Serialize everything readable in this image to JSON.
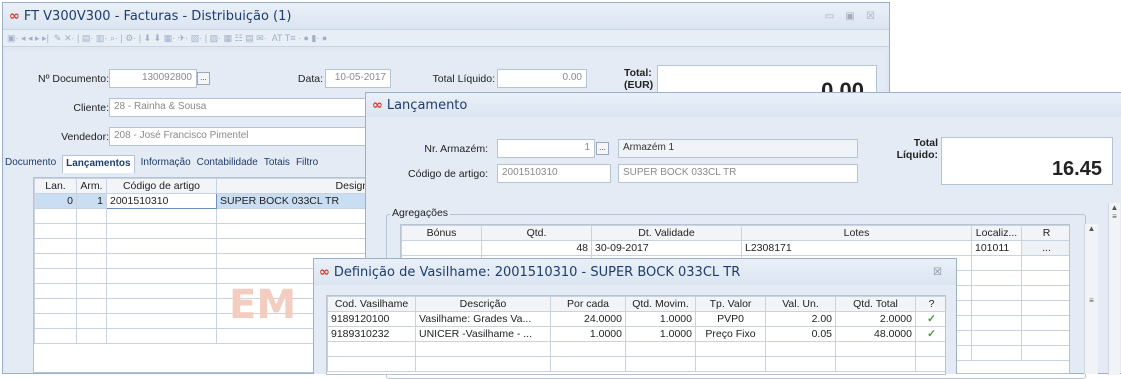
{
  "main": {
    "title": "FT V300V300 - Facturas - Distribuição (1)",
    "doc_label": "Nº Documento:",
    "doc_value": "130092800",
    "date_label": "Data:",
    "date_value": "10-05-2017",
    "total_liq_label": "Total Líquido:",
    "total_liq_value": "0.00",
    "total_label": "Total:",
    "total_unit": "(EUR)",
    "total_value": "0.00",
    "client_label": "Cliente:",
    "client_value": "28 - Rainha & Sousa",
    "seller_label": "Vendedor:",
    "seller_value": "208 - José Francisco Pimentel",
    "tabs": [
      "Documento",
      "Lançamentos",
      "Informação",
      "Contabilidade",
      "Totais",
      "Filtro"
    ],
    "grid_headers": [
      "Lan.",
      "Arm.",
      "Código de artigo",
      "Designação"
    ],
    "grid_row": [
      "0",
      "1",
      "2001510310",
      "SUPER BOCK 033CL TR"
    ],
    "watermark": "EM"
  },
  "lanc": {
    "title": "Lançamento",
    "armazem_label": "Nr. Armazém:",
    "armazem_value": "1",
    "armazem_name": "Armazém 1",
    "codigo_label": "Código de artigo:",
    "codigo_value": "2001510310",
    "codigo_name": "SUPER BOCK 033CL TR",
    "total_label": "Total",
    "liquido_label": "Líquido:",
    "total_value": "16.45",
    "agreg_label": "Agregações",
    "agreg_headers": [
      "Bónus",
      "Qtd.",
      "Dt. Validade",
      "Lotes",
      "Localiz...",
      "R"
    ],
    "agreg_row": [
      "",
      "48",
      "30-09-2017",
      "L2308171",
      "101011",
      "..."
    ]
  },
  "vas": {
    "title": "Definição de Vasilhame: 2001510310 - SUPER BOCK 033CL TR",
    "headers": [
      "Cod. Vasilhame",
      "Descrição",
      "Por cada",
      "Qtd. Movim.",
      "Tp. Valor",
      "Val. Un.",
      "Qtd. Total",
      "?"
    ],
    "rows": [
      [
        "9189120100",
        "Vasilhame: Grades Va...",
        "24.0000",
        "1.0000",
        "PVP0",
        "2.00",
        "2.0000",
        "✓"
      ],
      [
        "9189310232",
        "UNICER -Vasilhame - ...",
        "1.0000",
        "1.0000",
        "Preço Fixo",
        "0.05",
        "48.0000",
        "✓"
      ]
    ]
  }
}
